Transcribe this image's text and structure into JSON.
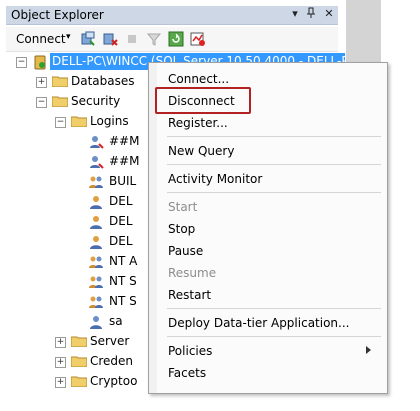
{
  "titlebar": {
    "title": "Object Explorer",
    "pin": "⊓",
    "close": "✕",
    "dropdown": "▾"
  },
  "toolbar": {
    "connect_label": "Connect",
    "icons": [
      "connect-object-explorer-icon",
      "disconnect-icon",
      "stop-icon",
      "filter-icon",
      "refresh-icon",
      "activity-monitor-icon"
    ]
  },
  "tree": {
    "server": "DELL-PC\\WINCC (SQL Server 10.50.4000 - DELL-P",
    "databases": "Databases",
    "security": "Security",
    "logins": "Logins",
    "login_items": [
      "##M",
      "##M",
      "BUIL",
      "DEL",
      "DEL",
      "DEL",
      "NT A",
      "NT S",
      "NT S",
      "sa"
    ],
    "server_objects": "Server",
    "credentials": "Creden",
    "cryptographic": "Cryptoo"
  },
  "context_menu": {
    "items": [
      {
        "label": "Connect...",
        "enabled": true
      },
      {
        "label": "Disconnect",
        "enabled": true
      },
      {
        "label": "Register...",
        "enabled": true
      },
      {
        "label": "New Query",
        "enabled": true
      },
      {
        "label": "Activity Monitor",
        "enabled": true
      },
      {
        "label": "Start",
        "enabled": false
      },
      {
        "label": "Stop",
        "enabled": true
      },
      {
        "label": "Pause",
        "enabled": true
      },
      {
        "label": "Resume",
        "enabled": false
      },
      {
        "label": "Restart",
        "enabled": true
      },
      {
        "label": "Deploy Data-tier Application...",
        "enabled": true
      },
      {
        "label": "Policies",
        "enabled": true
      },
      {
        "label": "Facets",
        "enabled": true
      }
    ]
  },
  "colors": {
    "selection": "#3399ff",
    "highlight_box": "#b22222",
    "titlebar": "#cdd7e6"
  }
}
